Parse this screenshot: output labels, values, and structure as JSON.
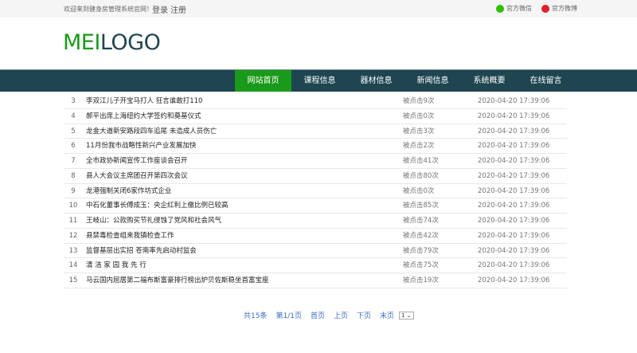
{
  "topbar": {
    "welcome": "欢迎来到健身房管理系统官网！",
    "login": "登录",
    "register": "注册",
    "wechat": "官方微信",
    "weibo": "官方微博"
  },
  "logo": {
    "part1": "MEI",
    "part2": "LOGO"
  },
  "nav": [
    "网站首页",
    "课程信息",
    "器材信息",
    "新闻信息",
    "系统概要",
    "在线留言"
  ],
  "news": [
    {
      "n": "3",
      "title": "李双江儿子开宝马打人 狂言谁敢打110",
      "clicks": "被点击9次",
      "date": "2020-04-20 17:39:06"
    },
    {
      "n": "4",
      "title": "郝平出席上海纽约大学签约和奠基仪式",
      "clicks": "被点击0次",
      "date": "2020-04-20 17:39:06"
    },
    {
      "n": "5",
      "title": "龙金大道新安路段四车追尾 未造成人员伤亡",
      "clicks": "被点击3次",
      "date": "2020-04-20 17:39:06"
    },
    {
      "n": "6",
      "title": "11月份我市战略性新兴产业发展加快",
      "clicks": "被点击2次",
      "date": "2020-04-20 17:39:06"
    },
    {
      "n": "7",
      "title": "全市政协新闻宣传工作座谈会召开",
      "clicks": "被点击41次",
      "date": "2020-04-20 17:39:06"
    },
    {
      "n": "8",
      "title": "县人大会议主席团召开第四次会议",
      "clicks": "被点击80次",
      "date": "2020-04-20 17:39:06"
    },
    {
      "n": "9",
      "title": "龙港强制关闭6家作坊式企业",
      "clicks": "被点击0次",
      "date": "2020-04-20 17:39:06"
    },
    {
      "n": "10",
      "title": "中石化董事长傅成玉：央企红利上缴比例已较高",
      "clicks": "被点击85次",
      "date": "2020-04-20 17:39:06"
    },
    {
      "n": "11",
      "title": "王岐山：公款购买节礼侵蚀了党风和社会风气",
      "clicks": "被点击74次",
      "date": "2020-04-20 17:39:06"
    },
    {
      "n": "12",
      "title": "县禁毒检查组来我镇检查工作",
      "clicks": "被点击42次",
      "date": "2020-04-20 17:39:06"
    },
    {
      "n": "13",
      "title": "监督基层出实招 苍南率先启动村监会",
      "clicks": "被点击79次",
      "date": "2020-04-20 17:39:06"
    },
    {
      "n": "14",
      "title": "清 洁 家 园 我 先 行",
      "clicks": "被点击75次",
      "date": "2020-04-20 17:39:06"
    },
    {
      "n": "15",
      "title": "马云国内屈居第二福布斯富豪排行榜出炉贝佐斯稳坐首富宝座",
      "clicks": "被点击19次",
      "date": "2020-04-20 17:39:06"
    }
  ],
  "pager": {
    "total": "共15条",
    "page": "第1/1页",
    "first": "首页",
    "prev": "上页",
    "next": "下页",
    "last": "末页",
    "select": "1"
  }
}
